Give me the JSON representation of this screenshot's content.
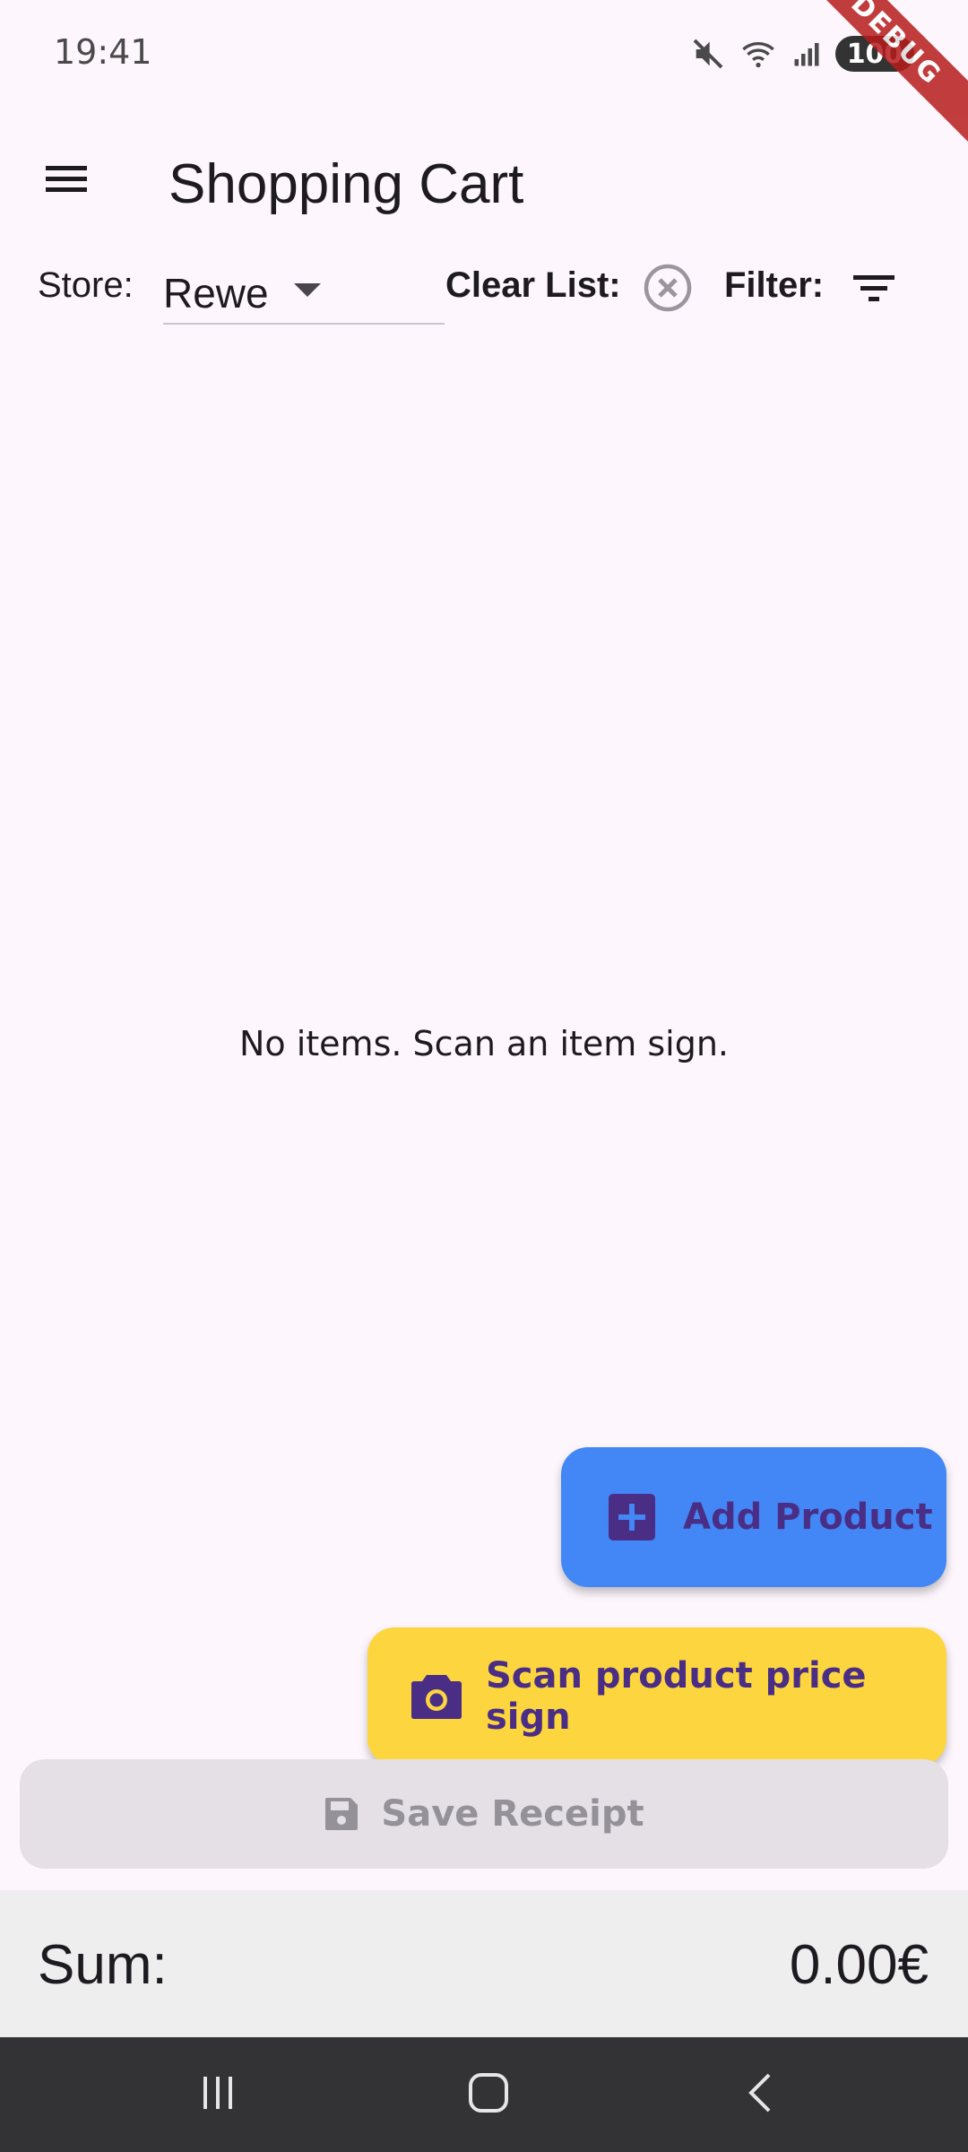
{
  "status_bar": {
    "time": "19:41",
    "battery": "100",
    "debug_banner": "DEBUG",
    "icons": [
      "mute-icon",
      "wifi-icon",
      "signal-icon",
      "battery-icon"
    ]
  },
  "app_bar": {
    "title": "Shopping Cart",
    "menu_icon": "menu-icon"
  },
  "toolbar": {
    "store_label": "Store:",
    "store_value": "Rewe",
    "clear_label": "Clear List:",
    "filter_label": "Filter:"
  },
  "empty_state": {
    "text": "No items. Scan an item sign."
  },
  "fabs": {
    "add_product_label": "Add Product",
    "add_product_color": "#4287f5",
    "scan_label": "Scan product price sign",
    "scan_color": "#fdd63f"
  },
  "save_receipt": {
    "label": "Save Receipt"
  },
  "sum_bar": {
    "label": "Sum:",
    "value": "0.00€"
  },
  "nav_bar": {
    "icons": [
      "recent-apps-icon",
      "home-icon",
      "back-icon"
    ]
  },
  "colors": {
    "background": "#fdf7fd",
    "fab_text": "#4a2e86",
    "sum_bar": "#eeeeee",
    "nav_bar": "#333235"
  }
}
